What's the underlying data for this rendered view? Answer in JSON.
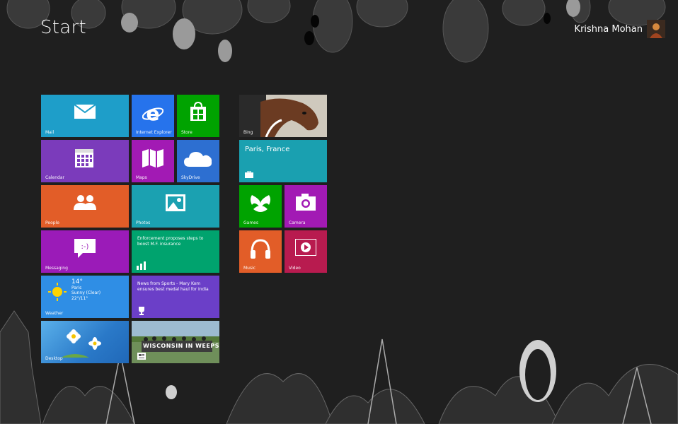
{
  "start_title": "Start",
  "user": {
    "name": "Krishna Mohan",
    "avatar_icon": "user-avatar-icon"
  },
  "tiles": {
    "mail": {
      "label": "Mail",
      "color": "#1e9ec9",
      "icon": "envelope-icon"
    },
    "ie": {
      "label": "Internet Explorer",
      "color": "#2673ec",
      "icon": "internet-explorer-icon"
    },
    "store": {
      "label": "Store",
      "color": "#00a300",
      "icon": "store-bag-icon"
    },
    "calendar": {
      "label": "Calendar",
      "color": "#7b3bbb",
      "icon": "calendar-icon"
    },
    "maps": {
      "label": "Maps",
      "color": "#a21ab4",
      "icon": "map-icon"
    },
    "skydrive": {
      "label": "SkyDrive",
      "color": "#2d6fd1",
      "icon": "cloud-icon"
    },
    "people": {
      "label": "People",
      "color": "#e25d28",
      "icon": "people-icon"
    },
    "photos": {
      "label": "Photos",
      "color": "#1ba1b1",
      "icon": "photo-icon"
    },
    "finance": {
      "label": "",
      "headline": "Enforcement proposes steps to boost M.F. insurance",
      "color": "#00a36e",
      "icon": "finance-chart-icon"
    },
    "messaging": {
      "label": "Messaging",
      "color": "#9b1bb8",
      "icon": "chat-bubble-icon"
    },
    "sports": {
      "label": "",
      "headline": "News from Sports - Mary Kom ensures best medal haul for India",
      "color": "#6b3fc8",
      "icon": "trophy-icon"
    },
    "weather": {
      "label": "Weather",
      "temp": "14°",
      "location": "Paris",
      "condition": "Sunny (Clear)",
      "range": "22°/11°",
      "color": "#2f8ee5",
      "icon": "sun-icon"
    },
    "desktop": {
      "label": "Desktop",
      "color": "#3c8bd4",
      "icon": "flower-wallpaper"
    },
    "news": {
      "label": "",
      "photo_caption": "WISCONSIN IN WEEPS",
      "color": "#555555",
      "icon": "newspaper-icon"
    },
    "bing": {
      "label": "Bing",
      "color": "#6b4c33",
      "icon": "horse-photo"
    },
    "travel": {
      "label": "",
      "city": "Paris, France",
      "color": "#1aa0b0",
      "icon": "suitcase-icon"
    },
    "games": {
      "label": "Games",
      "color": "#00a300",
      "icon": "xbox-icon"
    },
    "camera": {
      "label": "Camera",
      "color": "#a21ab4",
      "icon": "camera-icon"
    },
    "music": {
      "label": "Music",
      "color": "#e25d28",
      "icon": "headphones-icon"
    },
    "video": {
      "label": "Video",
      "color": "#b81b4f",
      "icon": "play-icon"
    }
  }
}
